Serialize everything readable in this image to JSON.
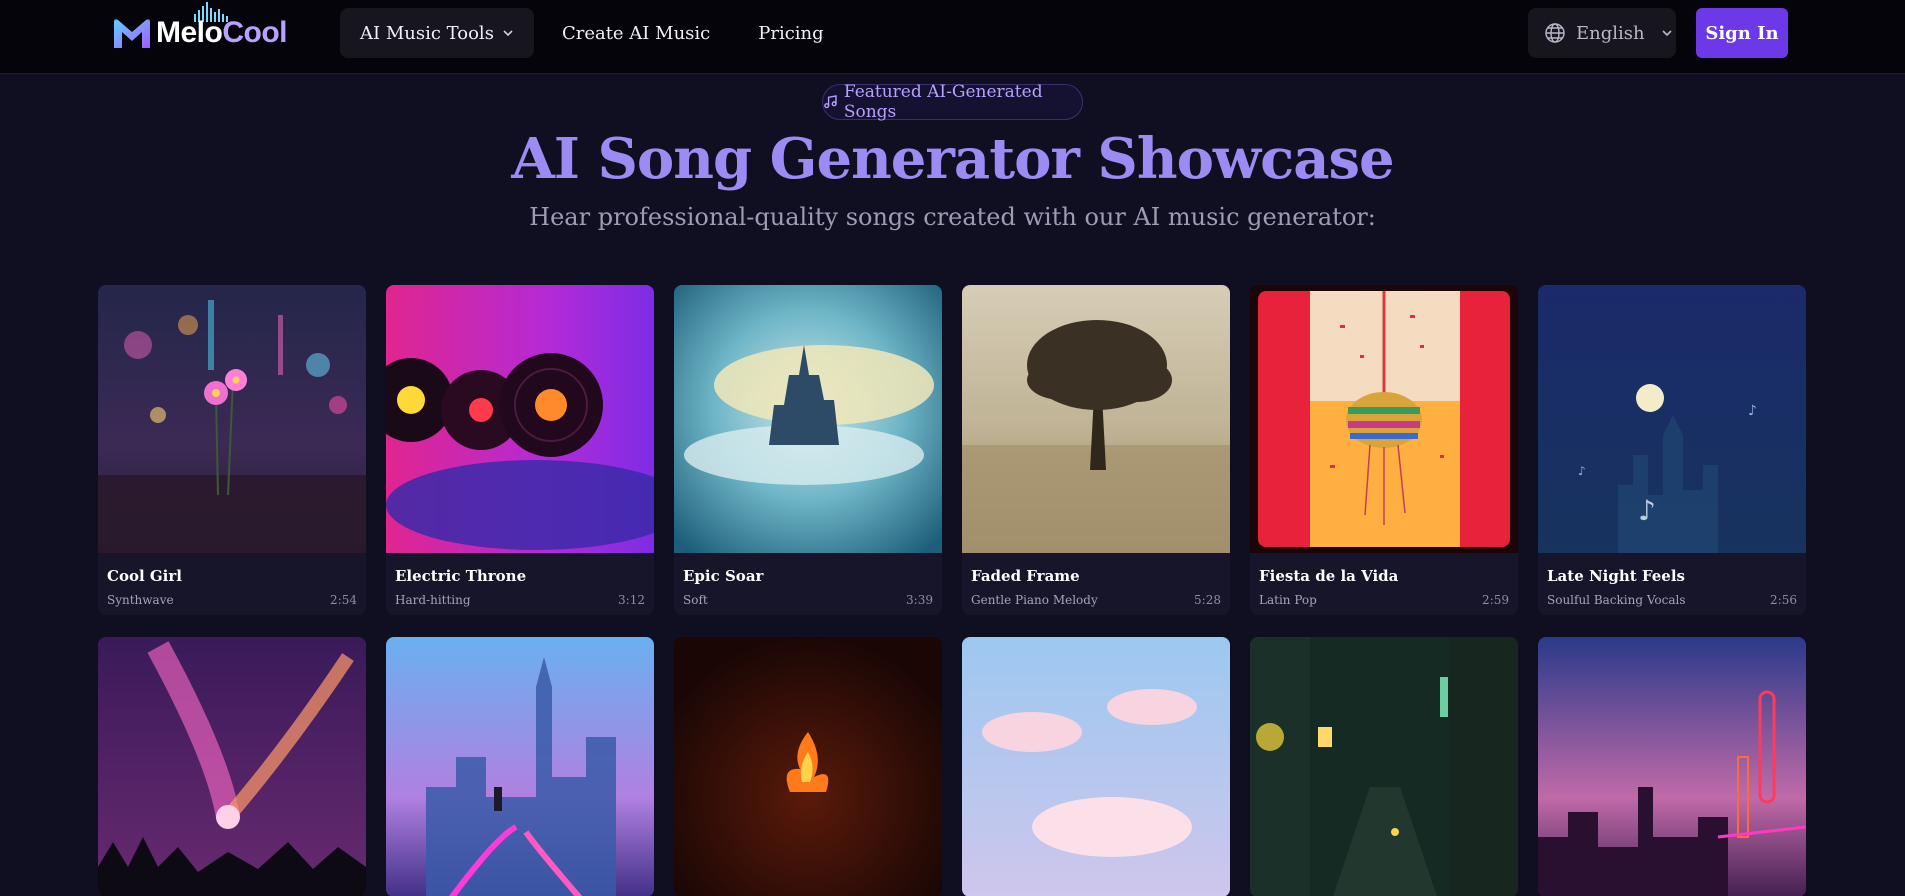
{
  "header": {
    "logo": {
      "part1": "Melo",
      "part2": "Cool"
    },
    "nav": [
      {
        "label": "AI Music Tools",
        "has_dropdown": true
      },
      {
        "label": "Create AI Music",
        "has_dropdown": false
      },
      {
        "label": "Pricing",
        "has_dropdown": false
      }
    ],
    "language": {
      "label": "English",
      "icon": "globe-icon"
    },
    "signin_label": "Sign In"
  },
  "hero": {
    "badge": "Featured AI-Generated Songs",
    "badge_icon": "music-note-icon",
    "title": "AI Song Generator Showcase",
    "subtitle": "Hear professional-quality songs created with our AI music generator:"
  },
  "songs": [
    {
      "title": "Cool Girl",
      "genre": "Synthwave",
      "duration": "2:54"
    },
    {
      "title": "Electric Throne",
      "genre": "Hard-hitting",
      "duration": "3:12"
    },
    {
      "title": "Epic Soar",
      "genre": "Soft",
      "duration": "3:39"
    },
    {
      "title": "Faded Frame",
      "genre": "Gentle Piano Melody",
      "duration": "5:28"
    },
    {
      "title": "Fiesta de la Vida",
      "genre": "Latin Pop",
      "duration": "2:59"
    },
    {
      "title": "Late Night Feels",
      "genre": "Soulful Backing Vocals",
      "duration": "2:56"
    }
  ],
  "colors": {
    "accent": "#6d38e8",
    "title_gradient_start": "#8b78f0",
    "background": "#100f22"
  }
}
